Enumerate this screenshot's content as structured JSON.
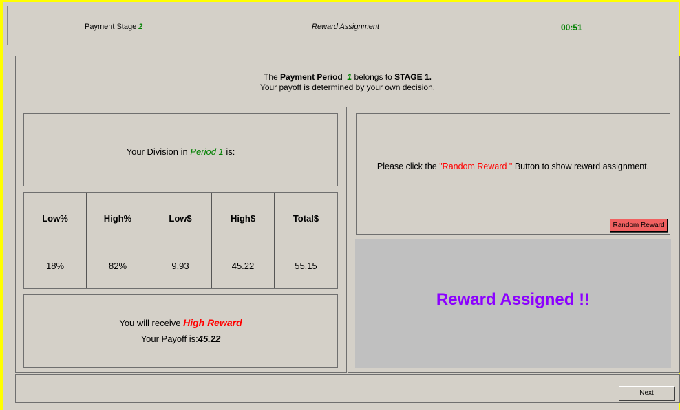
{
  "header": {
    "stage_label": "Payment Stage",
    "stage_value": "2",
    "title": "Reward Assignment",
    "timer": "00:51"
  },
  "info": {
    "line1_pre": "The ",
    "line1_bold": "Payment Period",
    "line1_period": "1",
    "line1_mid": " belongs to ",
    "line1_stage": "STAGE 1.",
    "line2": "Your payoff is determined by your own decision."
  },
  "division": {
    "pre": "Your Division in ",
    "period": "Period 1",
    "post": " is:"
  },
  "table": {
    "headers": [
      "Low%",
      "High%",
      "Low$",
      "High$",
      "Total$"
    ],
    "values": [
      "18%",
      "82%",
      "9.93",
      "45.22",
      "55.15"
    ]
  },
  "result": {
    "receive_pre": "You will receive ",
    "receive_value": "High Reward",
    "payoff_label": "Your Payoff is:",
    "payoff_value": "45.22"
  },
  "instruction": {
    "pre": "Please click the ",
    "button_name": "\"Random Reward \"",
    "post": " Button to show reward assignment."
  },
  "random_button_label": "Random Reward",
  "assigned_text": "Reward Assigned !!",
  "next_button_label": "Next",
  "colors": {
    "background": "#d4d0c8",
    "highlight_border": "#ffff00",
    "green": "#008000",
    "red": "#ff0000",
    "purple": "#8b00ff",
    "button_red": "#f06060",
    "panel_gray": "#c0c0c0"
  }
}
